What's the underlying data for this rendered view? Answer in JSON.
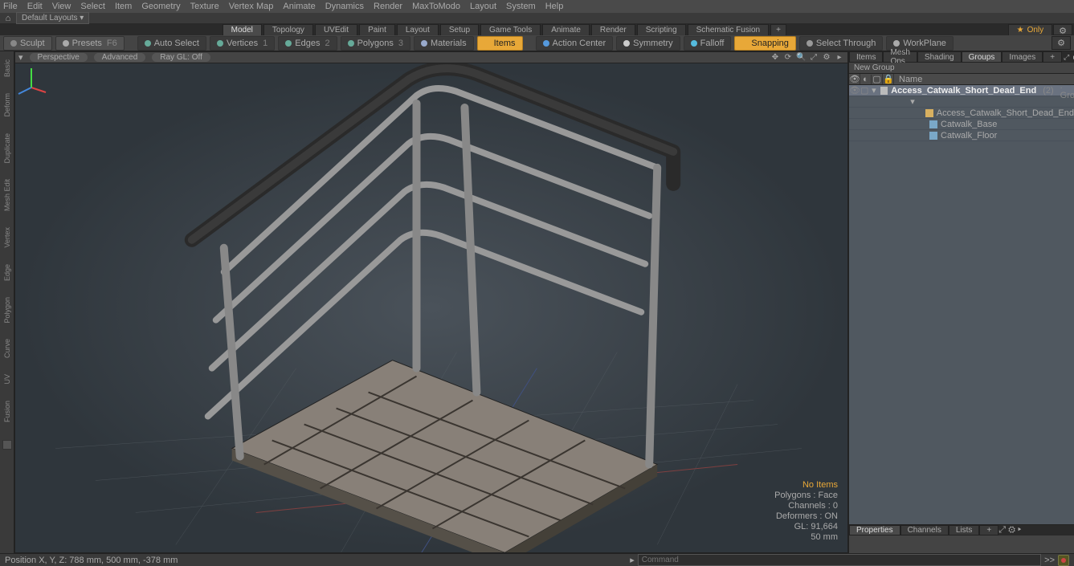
{
  "menu": [
    "File",
    "Edit",
    "View",
    "Select",
    "Item",
    "Geometry",
    "Texture",
    "Vertex Map",
    "Animate",
    "Dynamics",
    "Render",
    "MaxToModo",
    "Layout",
    "System",
    "Help"
  ],
  "layout": {
    "default": "Default Layouts ▾"
  },
  "tabs": [
    "Model",
    "Topology",
    "UVEdit",
    "Paint",
    "Layout",
    "Setup",
    "Game Tools",
    "Animate",
    "Render",
    "Scripting",
    "Schematic Fusion"
  ],
  "tabs_active": 0,
  "only": "Only",
  "toolbar": {
    "sculpt": "Sculpt",
    "presets": "Presets",
    "presets_suffix": "F6",
    "autosel": "Auto Select",
    "vertices": "Vertices",
    "vertices_key": "1",
    "edges": "Edges",
    "edges_key": "2",
    "polygons": "Polygons",
    "polygons_key": "3",
    "materials": "Materials",
    "items": "Items",
    "action": "Action Center",
    "symmetry": "Symmetry",
    "falloff": "Falloff",
    "snapping": "Snapping",
    "selthrough": "Select Through",
    "workplane": "WorkPlane"
  },
  "lefttabs": [
    "Basic",
    "Deform",
    "Duplicate",
    "Mesh Edit",
    "Vertex",
    "Edge",
    "Polygon",
    "Curve",
    "UV",
    "Fusion"
  ],
  "viewport": {
    "mode": "Perspective",
    "advanced": "Advanced",
    "raygl": "Ray GL: Off"
  },
  "stats": {
    "noitems": "No Items",
    "polygons": "Polygons : Face",
    "channels": "Channels : 0",
    "deformers": "Deformers : ON",
    "gl": "GL: 91,664",
    "grid": "50 mm"
  },
  "rtabs": [
    "Items",
    "Mesh Ops",
    "Shading",
    "Groups",
    "Images"
  ],
  "rtabs_active": 3,
  "newgroup": "New Group",
  "treehead": "Name",
  "tree": {
    "root": {
      "name": "Access_Catwalk_Short_Dead_End",
      "count": "(2)",
      "type": ": Group"
    },
    "children": [
      {
        "name": "Access_Catwalk_Short_Dead_End",
        "icon": "loc"
      },
      {
        "name": "Catwalk_Base",
        "icon": "mesh"
      },
      {
        "name": "Catwalk_Floor",
        "icon": "mesh"
      }
    ]
  },
  "proptabs": [
    "Properties",
    "Channels",
    "Lists"
  ],
  "proptabs_active": 0,
  "status": {
    "pos": "Position X, Y, Z:   788 mm,  500 mm,  -378 mm",
    "cmd_placeholder": "Command",
    "chev": ">>"
  }
}
